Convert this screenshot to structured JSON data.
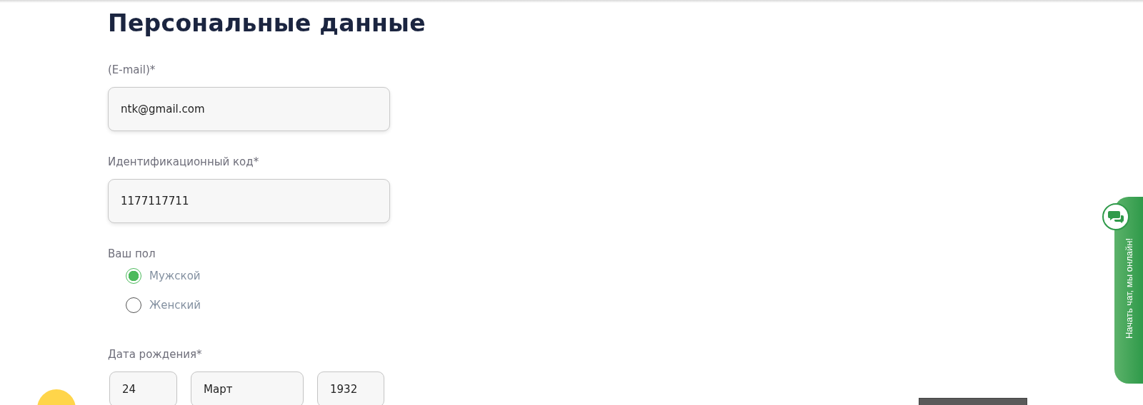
{
  "heading": "Персональные данные",
  "fields": [
    {
      "label": "(E-mail)*",
      "value": "ntk@gmail.com"
    },
    {
      "label": "Идентификационный код*",
      "value": "1177117711"
    }
  ],
  "gender": {
    "label": "Ваш пол",
    "options": [
      {
        "label": "Мужской",
        "selected": true
      },
      {
        "label": "Женский",
        "selected": false
      }
    ]
  },
  "birth_date": {
    "label": "Дата рождения*",
    "day": "24",
    "month": "Март",
    "year": "1932"
  },
  "chat_tab": {
    "label": "Начать чат, мы онлайн!"
  }
}
